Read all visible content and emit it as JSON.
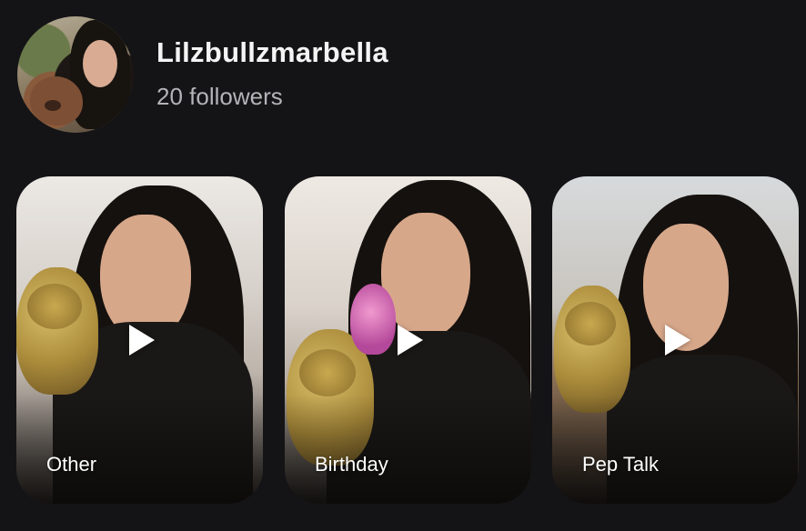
{
  "profile": {
    "username": "Lilzbullzmarbella",
    "followers_text": "20 followers",
    "avatar_icon": "profile-photo"
  },
  "videos": [
    {
      "label": "Other",
      "icon": "play-icon"
    },
    {
      "label": "Birthday",
      "icon": "play-icon"
    },
    {
      "label": "Pep Talk",
      "icon": "play-icon"
    }
  ],
  "colors": {
    "background": "#141416",
    "username": "#f4f4f4",
    "followers": "#b4b4b8",
    "card_label": "#ffffff"
  }
}
